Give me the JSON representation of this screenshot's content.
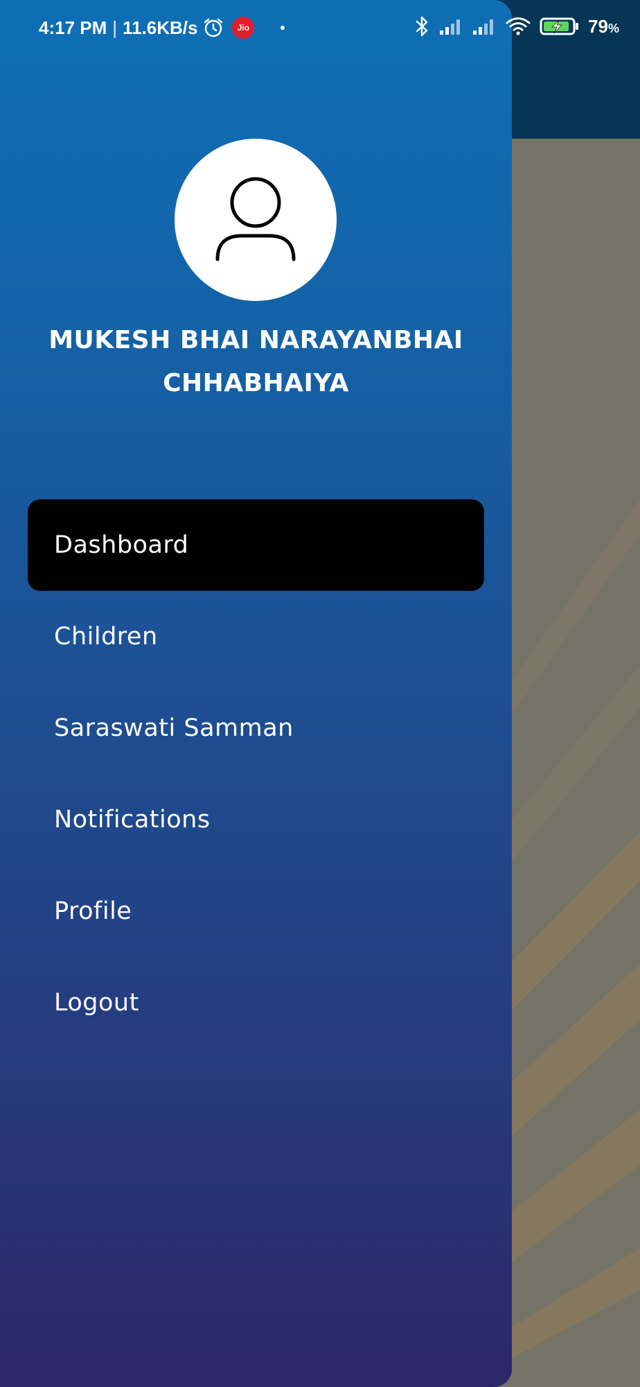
{
  "status_bar": {
    "time": "4:17 PM",
    "net_speed": "11.6KB/s",
    "carrier_badge": "Jio",
    "battery_percent": "79",
    "battery_unit": "%",
    "icons": [
      "alarm-icon",
      "bluetooth-icon",
      "signal-icon",
      "wifi-icon",
      "battery-charging-icon"
    ]
  },
  "drawer": {
    "avatar_icon": "user-icon",
    "user_name": "MUKESH BHAI NARAYANBHAI CHHABHAIYA",
    "menu": [
      {
        "label": "Dashboard",
        "active": true
      },
      {
        "label": "Children",
        "active": false
      },
      {
        "label": "Saraswati Samman",
        "active": false
      },
      {
        "label": "Notifications",
        "active": false
      },
      {
        "label": "Profile",
        "active": false
      },
      {
        "label": "Logout",
        "active": false
      }
    ]
  },
  "colors": {
    "drawer_top": "#0e6fb5",
    "drawer_bottom": "#2c2768",
    "active_item": "#000000",
    "background_appbar": "#063556",
    "jio_red": "#e01d2a"
  }
}
